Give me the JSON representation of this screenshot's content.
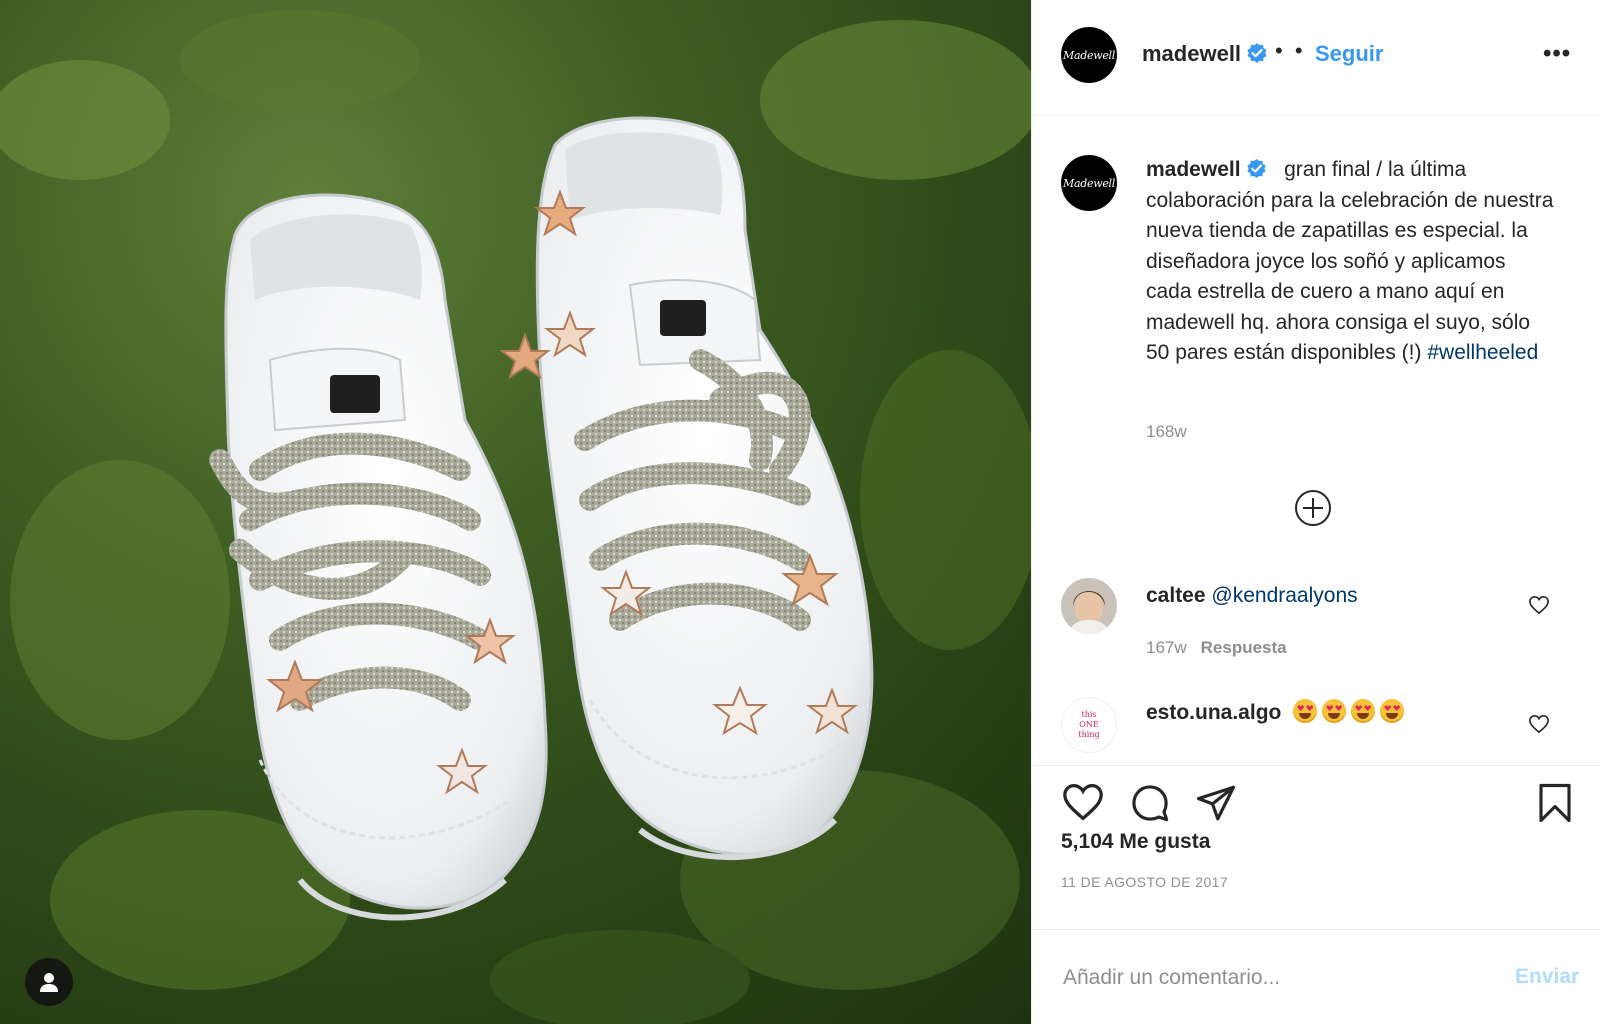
{
  "post": {
    "username": "madewell",
    "avatar_text": "Madewell",
    "header_separator": "• •",
    "follow_label": "Seguir",
    "more_label": "•••",
    "icons": {
      "verified": "verified-badge-icon",
      "more": "more-options-icon",
      "user_tag": "user-tag-icon",
      "load_more": "plus-circle-icon",
      "like": "heart-icon",
      "comment": "comment-bubble-icon",
      "share": "paper-plane-icon",
      "save": "bookmark-icon"
    },
    "colors": {
      "link": "#3897f0",
      "hashtag": "#00376b",
      "muted": "#8e8e8e",
      "send_disabled": "#b3dbff"
    }
  },
  "caption": {
    "username": "madewell",
    "text": "gran final / la última colaboración para la celebración de nuestra nueva tienda de zapatillas es especial. la diseñadora joyce los soñó y aplicamos cada estrella de cuero a mano aquí en madewell hq. ahora consiga el suyo, sólo 50 pares están disponibles (!)",
    "hashtag": "#wellheeled",
    "time": "168w"
  },
  "comments": [
    {
      "username": "caltee",
      "mention": "@kendraalyons",
      "time": "167w",
      "reply_label": "Respuesta"
    },
    {
      "username": "esto.una.algo",
      "avatar_text": [
        "this",
        "ONE",
        "thing"
      ],
      "emoji": [
        "heart-eyes",
        "heart-eyes",
        "heart-eyes",
        "heart-eyes"
      ]
    }
  ],
  "engagement": {
    "likes": "5,104 Me gusta",
    "date": "11 DE AGOSTO DE 2017"
  },
  "composer": {
    "placeholder": "Añadir un comentario...",
    "send_label": "Enviar"
  }
}
